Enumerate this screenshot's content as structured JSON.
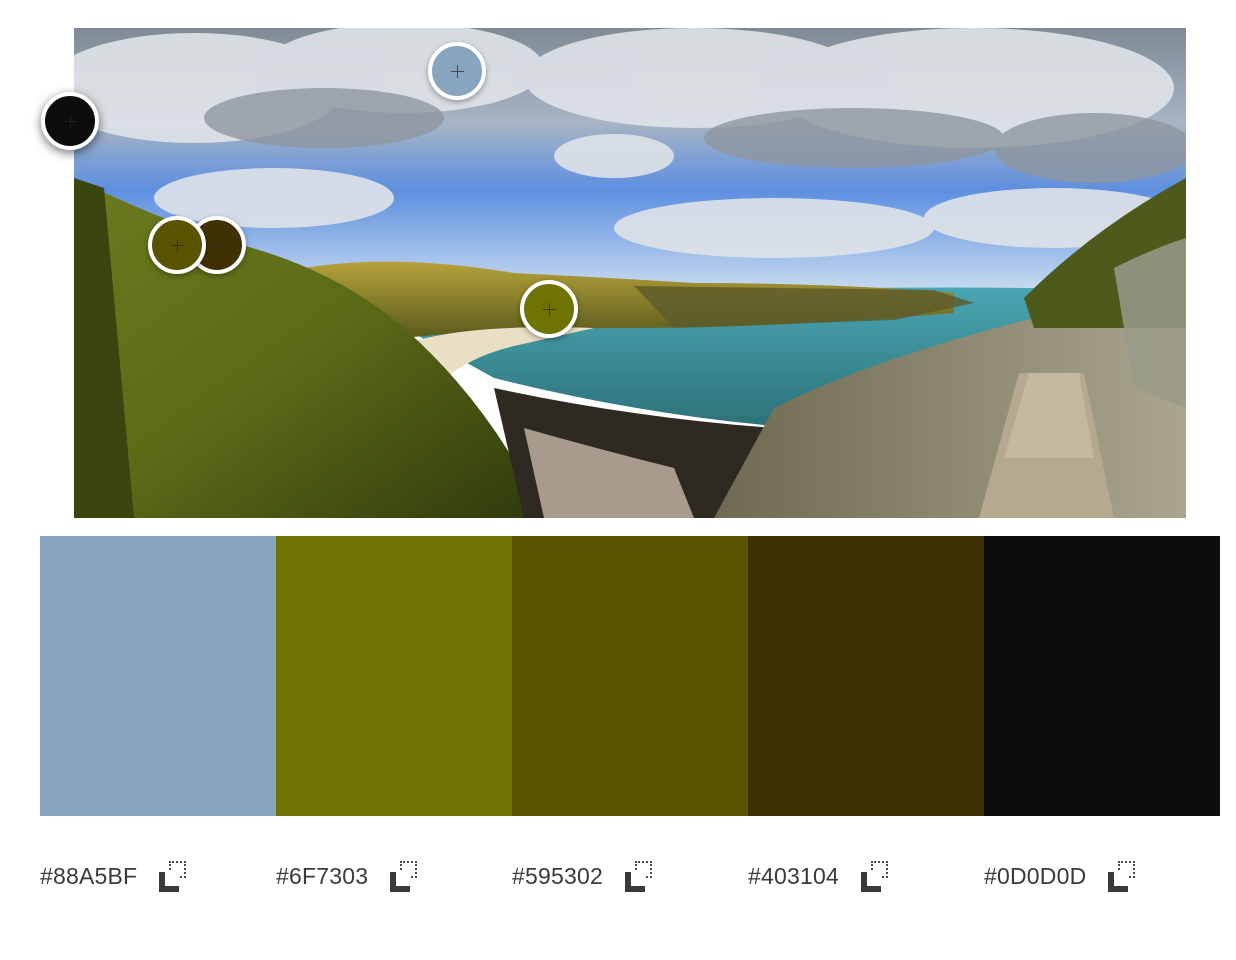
{
  "swatches": [
    {
      "hex": "#88A5BF",
      "color": "#88A5BF"
    },
    {
      "hex": "#6F7303",
      "color": "#6F7303"
    },
    {
      "hex": "#595302",
      "color": "#595302"
    },
    {
      "hex": "#403104",
      "color": "#403104"
    },
    {
      "hex": "#0D0D0D",
      "color": "#0D0D0D"
    }
  ],
  "icons": {
    "copy": "copy-icon",
    "marker": "plus-icon"
  }
}
